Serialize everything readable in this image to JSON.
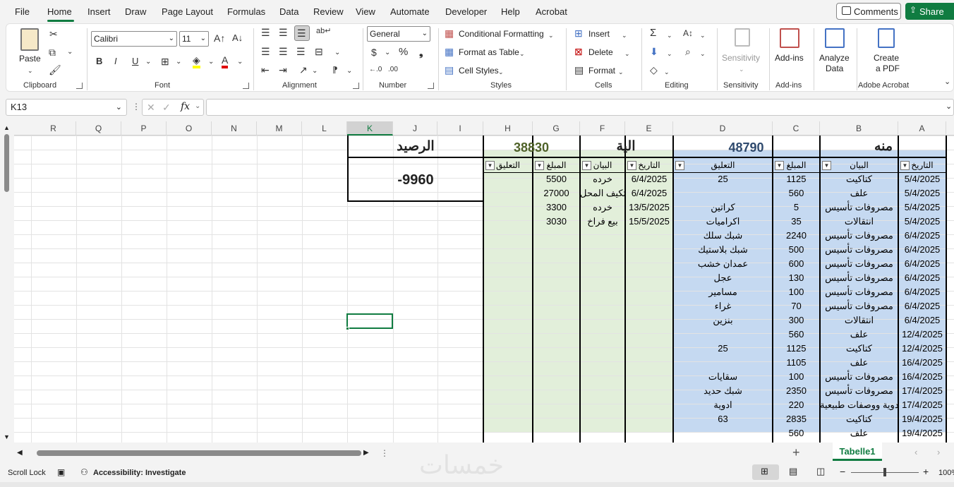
{
  "menu": {
    "tabs": [
      "File",
      "Home",
      "Insert",
      "Draw",
      "Page Layout",
      "Formulas",
      "Data",
      "Review",
      "View",
      "Automate",
      "Developer",
      "Help",
      "Acrobat"
    ],
    "comments": "Comments",
    "share": "Share"
  },
  "ribbon": {
    "clipboard": {
      "paste": "Paste",
      "label": "Clipboard"
    },
    "font": {
      "name": "Calibri",
      "size": "11",
      "bold": "B",
      "italic": "I",
      "underline": "U",
      "label": "Font"
    },
    "alignment": {
      "label": "Alignment"
    },
    "number": {
      "format": "General",
      "label": "Number"
    },
    "styles": {
      "conditional": "Conditional Formatting",
      "table": "Format as Table",
      "cell": "Cell Styles",
      "label": "Styles"
    },
    "cells": {
      "insert": "Insert",
      "delete": "Delete",
      "format": "Format",
      "label": "Cells"
    },
    "editing": {
      "label": "Editing"
    },
    "sensitivity": {
      "btn": "Sensitivity",
      "label": "Sensitivity"
    },
    "addins": {
      "btn": "Add-ins",
      "label": "Add-ins"
    },
    "analyze": {
      "btn1": "Analyze",
      "btn2": "Data"
    },
    "acrobat": {
      "btn1": "Create",
      "btn2": "a PDF",
      "label": "Adobe Acrobat"
    }
  },
  "formula_bar": {
    "name_box": "K13",
    "fx": "fx",
    "value": ""
  },
  "columns": [
    "R",
    "Q",
    "P",
    "O",
    "N",
    "M",
    "L",
    "K",
    "J",
    "I",
    "H",
    "G",
    "F",
    "E",
    "D",
    "C",
    "B",
    "A"
  ],
  "sheet": {
    "balance_label": "الرصيد",
    "balance_value": "-9960",
    "in_total": "38830",
    "in_title": "الية",
    "out_total": "48790",
    "out_title": "منه",
    "in_headers": {
      "comment": "التعليق",
      "amount": "المبلغ",
      "desc": "البيان",
      "date": "التاريخ"
    },
    "out_headers": {
      "comment": "التعليق",
      "amount": "المبلغ",
      "desc": "البيان",
      "date": "التاريخ"
    },
    "in_rows": [
      {
        "amount": "5500",
        "desc": "خرده",
        "date": "6/4/2025"
      },
      {
        "amount": "27000",
        "desc": "تكيف المحل",
        "date": "6/4/2025"
      },
      {
        "amount": "3300",
        "desc": "خرده",
        "date": "13/5/2025"
      },
      {
        "amount": "3030",
        "desc": "بيع فراخ",
        "date": "15/5/2025"
      }
    ],
    "out_rows": [
      {
        "comment": "25",
        "amount": "1125",
        "desc": "كتاكيت",
        "date": "5/4/2025"
      },
      {
        "comment": "",
        "amount": "560",
        "desc": "علف",
        "date": "5/4/2025"
      },
      {
        "comment": "كراتين",
        "amount": "5",
        "desc": "مصروفات تأسيس",
        "date": "5/4/2025"
      },
      {
        "comment": "اكراميات",
        "amount": "35",
        "desc": "انتقالات",
        "date": "5/4/2025"
      },
      {
        "comment": "شبك سلك",
        "amount": "2240",
        "desc": "مصروفات تأسيس",
        "date": "6/4/2025"
      },
      {
        "comment": "شبك بلاستيك",
        "amount": "500",
        "desc": "مصروفات تأسيس",
        "date": "6/4/2025"
      },
      {
        "comment": "عمدان خشب",
        "amount": "600",
        "desc": "مصروفات تأسيس",
        "date": "6/4/2025"
      },
      {
        "comment": "عجل",
        "amount": "130",
        "desc": "مصروفات تأسيس",
        "date": "6/4/2025"
      },
      {
        "comment": "مسامير",
        "amount": "100",
        "desc": "مصروفات تأسيس",
        "date": "6/4/2025"
      },
      {
        "comment": "غراء",
        "amount": "70",
        "desc": "مصروفات تأسيس",
        "date": "6/4/2025"
      },
      {
        "comment": "بنزين",
        "amount": "300",
        "desc": "انتقالات",
        "date": "6/4/2025"
      },
      {
        "comment": "",
        "amount": "560",
        "desc": "علف",
        "date": "12/4/2025"
      },
      {
        "comment": "25",
        "amount": "1125",
        "desc": "كتاكيت",
        "date": "12/4/2025"
      },
      {
        "comment": "",
        "amount": "1105",
        "desc": "علف",
        "date": "16/4/2025"
      },
      {
        "comment": "سقايات",
        "amount": "100",
        "desc": "مصروفات تأسيس",
        "date": "16/4/2025"
      },
      {
        "comment": "شبك حديد",
        "amount": "2350",
        "desc": "مصروفات تأسيس",
        "date": "17/4/2025"
      },
      {
        "comment": "ادوية",
        "amount": "220",
        "desc": "ادوية ووصفات طبيعية",
        "date": "17/4/2025"
      },
      {
        "comment": "63",
        "amount": "2835",
        "desc": "كتاكيت",
        "date": "19/4/2025"
      },
      {
        "comment": "",
        "amount": "560",
        "desc": "علف",
        "date": "19/4/2025"
      }
    ]
  },
  "tabs": {
    "sheet": "Tabelle1"
  },
  "status": {
    "mode": "Scroll Lock",
    "accessibility": "Accessibility: Investigate",
    "zoom": "100%",
    "watermark": "خمسات"
  }
}
